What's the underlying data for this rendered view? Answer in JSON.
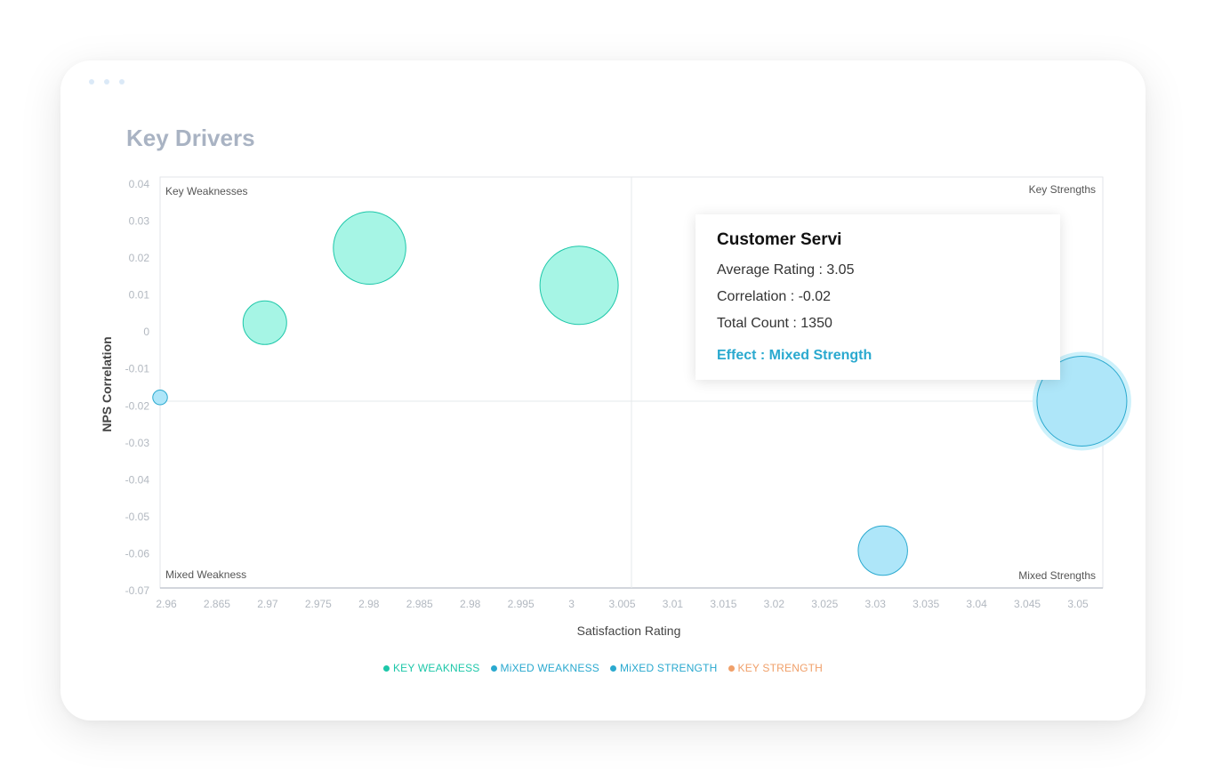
{
  "title": "Key Drivers",
  "chart_data": {
    "type": "scatter",
    "subtype": "bubble",
    "title": "Key Drivers",
    "xlabel": "Satisfaction Rating",
    "ylabel": "NPS Correlation",
    "x_ticks": [
      "2.96",
      "2.865",
      "2.97",
      "2.975",
      "2.98",
      "2.985",
      "2.98",
      "2.995",
      "3",
      "3.005",
      "3.01",
      "3.015",
      "3.02",
      "3.025",
      "3.03",
      "3.035",
      "3.04",
      "3.045",
      "3.05"
    ],
    "y_ticks": [
      "0.04",
      "0.03",
      "0.02",
      "0.01",
      "0",
      "-0.01",
      "-0.02",
      "-0.03",
      "-0.04",
      "-0.05",
      "-0.06",
      "-0.07"
    ],
    "xlim": [
      2.96,
      3.05
    ],
    "ylim": [
      -0.07,
      0.04
    ],
    "x_divider": 3.005,
    "y_divider": -0.02,
    "quadrant_labels": {
      "top_left": "Key Weaknesses",
      "top_right": "Key Strengths",
      "bottom_left": "Mixed Weakness",
      "bottom_right": "Mixed Strengths"
    },
    "series": [
      {
        "name": "KEY WEAKNESS",
        "color": "#1dc7a9",
        "points": [
          {
            "x": 2.97,
            "y": 0.001,
            "size": 6
          },
          {
            "x": 2.98,
            "y": 0.021,
            "size": 11
          },
          {
            "x": 3.0,
            "y": 0.011,
            "size": 12
          }
        ]
      },
      {
        "name": "MiXED WEAKNESS",
        "color": "#2aa9cf",
        "points": [
          {
            "x": 2.96,
            "y": -0.019,
            "size": 1
          }
        ]
      },
      {
        "name": "MiXED STRENGTH",
        "color": "#2aa9cf",
        "points": [
          {
            "x": 3.048,
            "y": -0.02,
            "size": 14
          },
          {
            "x": 3.029,
            "y": -0.06,
            "size": 7
          }
        ]
      },
      {
        "name": "KEY STRENGTH",
        "color": "#f0a06a",
        "points": []
      }
    ],
    "legend_position": "bottom",
    "grid": false
  },
  "tooltip": {
    "title": "Customer Servi",
    "average_rating": "Average Rating : 3.05",
    "correlation": "Correlation : -0.02",
    "total_count": "Total Count : 1350",
    "effect": "Effect : Mixed Strength"
  }
}
